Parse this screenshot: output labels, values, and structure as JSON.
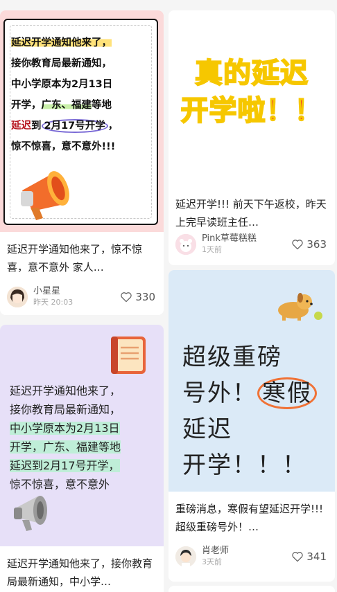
{
  "feed": {
    "posts": [
      {
        "cover_text_lines": [
          "延迟开学通知他来了，",
          "接你教育局最新通知，",
          "中小学原本为2月13日",
          "开学，",
          "广东、福建",
          "等地",
          "延迟",
          "到",
          "2月17号开学",
          "，",
          "惊不惊喜，意不意外!!!"
        ],
        "title": "延迟开学通知他来了，惊不惊喜，意不意外 家人…",
        "author": "小星星",
        "time": "昨天 20:03",
        "likes": "330",
        "accent": "#fbdada"
      },
      {
        "cover_big_lines": [
          "真的延迟",
          "开学啦！！"
        ],
        "title": "延迟开学!!!  前天下午返校，昨天上完早读班主任…",
        "author": "Pink草莓糕糕",
        "time": "1天前",
        "likes": "363",
        "accent": "#f03a2e"
      },
      {
        "cover_text_lines": [
          "延迟开学通知他来了，",
          "接你教育局最新通知，",
          "中小学原本为2月13日",
          "开学，广东、福建等地",
          "延迟到2月17号开学，",
          "惊不惊喜，意不意外"
        ],
        "title": "延迟开学通知他来了，接你教育局最新通知，中小学…",
        "accent": "#e7e0f8"
      },
      {
        "cover_text_lines": [
          "超级重磅",
          "号外！",
          "寒假",
          "延迟",
          "开学！！！"
        ],
        "title": "重磅消息，寒假有望延迟开学!!!  超级重磅号外！…",
        "author": "肖老师",
        "time": "3天前",
        "likes": "341",
        "accent": "#dbeaf7"
      }
    ]
  },
  "icons": {
    "like": "heart-outline-icon",
    "megaphone": "megaphone-icon",
    "book": "book-icon",
    "dog": "dog-icon"
  }
}
